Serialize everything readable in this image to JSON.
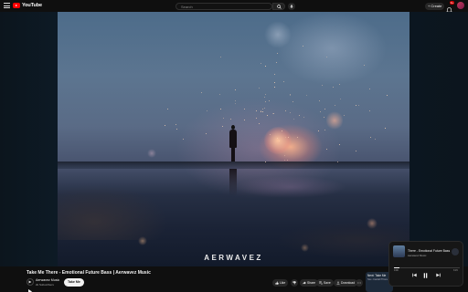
{
  "header": {
    "logo_text": "YouTube",
    "search_placeholder": "Search",
    "create_label": "Create",
    "notification_count": "9+"
  },
  "video": {
    "watermark": "AERWAVEZ",
    "title": "Take Me There - Emotional Future Bass | Aerwavez Music"
  },
  "channel": {
    "name": "Aerwavez Music",
    "subscribers": "2k Subscribers",
    "subscribe_label": "Take Me"
  },
  "actions": {
    "like_label": "Like",
    "share_label": "Share",
    "save_label": "Save",
    "download_label": "Download"
  },
  "next": {
    "title": "Next: Take Me",
    "subtitle": "Sia • Cardell Thora"
  },
  "mini_player": {
    "title": "There - Emotional Future Bass",
    "channel": "Aerwavez Music",
    "time_current": "0:00",
    "time_total": "3:15",
    "progress": 0.08
  },
  "colors": {
    "background": "#0f0f0f",
    "brand_red": "#ff0000",
    "button_surface": "#272727"
  }
}
